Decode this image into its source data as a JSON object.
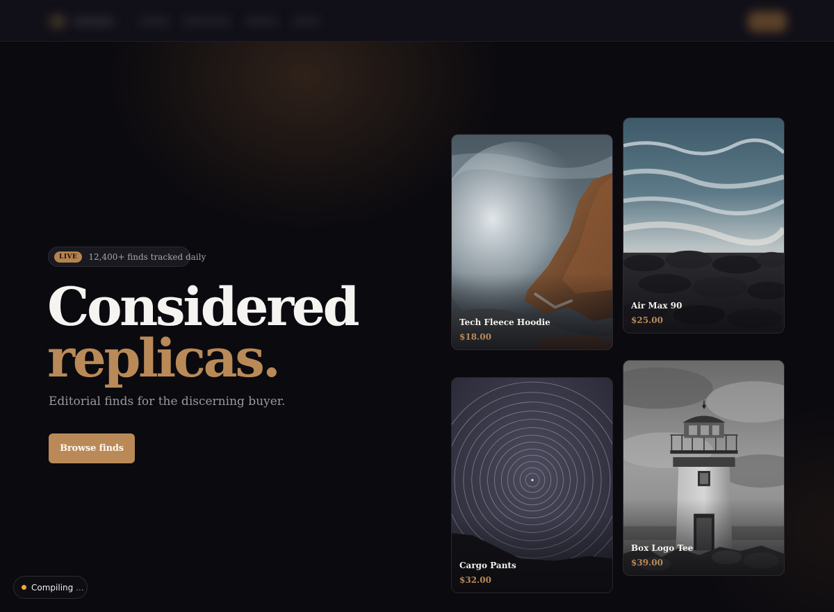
{
  "colors": {
    "background": "#0b0a0f",
    "accent": "#b98a58",
    "heading": "#f6f4f1",
    "muted_text": "#9d98a0",
    "status_dot": "#f0a93a"
  },
  "hero": {
    "badge": {
      "live_label": "LIVE",
      "text": "12,400+ finds tracked daily"
    },
    "headline_line1": "Considered",
    "headline_line2": "replicas.",
    "tagline": "Editorial finds for the discerning buyer.",
    "cta_label": "Browse finds"
  },
  "products": [
    {
      "title": "Tech Fleece Hoodie",
      "price": "$18.00",
      "image": "wave-crashing-on-rock"
    },
    {
      "title": "Air Max 90",
      "price": "$25.00",
      "image": "ocean-surf-over-rocks"
    },
    {
      "title": "Cargo Pants",
      "price": "$32.00",
      "image": "star-trails-night-sky"
    },
    {
      "title": "Box Logo Tee",
      "price": "$39.00",
      "image": "lighthouse-black-white"
    }
  ],
  "status": {
    "label": "Compiling",
    "ellipsis": "..."
  }
}
